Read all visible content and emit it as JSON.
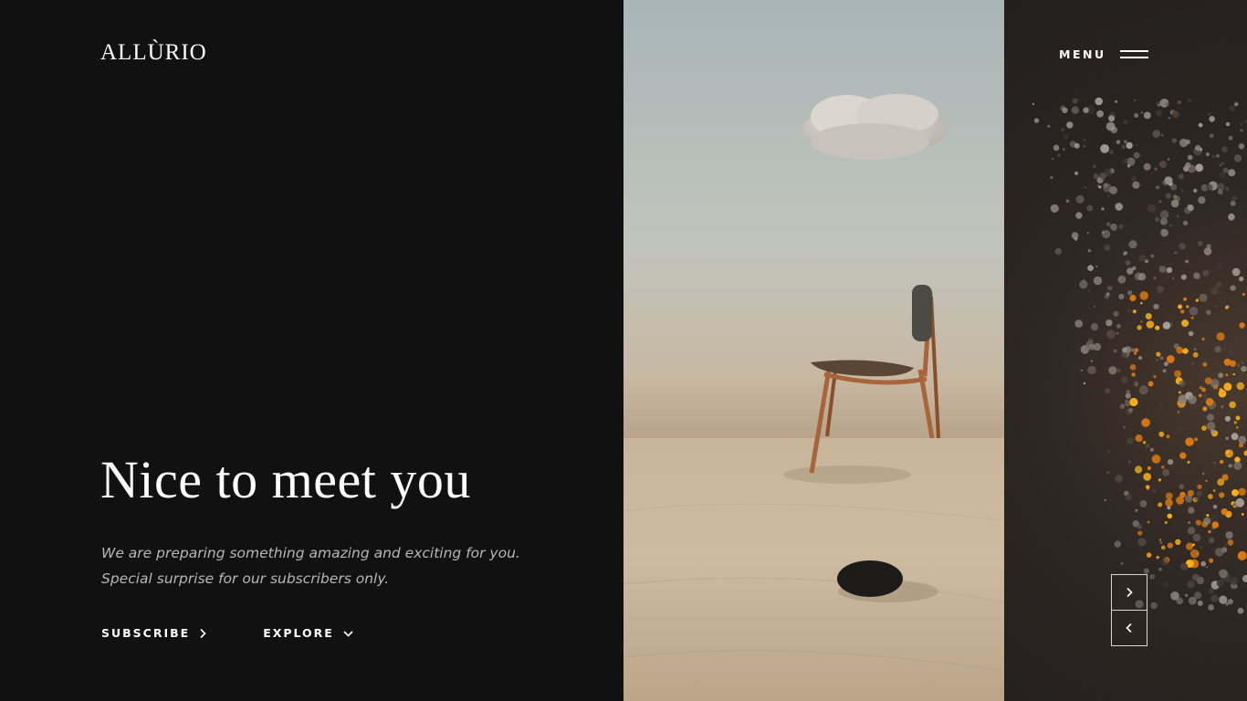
{
  "brand": {
    "logo": "ALLÙRIO"
  },
  "header": {
    "menu_label": "MENU",
    "menu_icon": "hamburger-icon"
  },
  "hero": {
    "title": "Nice to meet you",
    "description_lines": [
      "We are preparing something amazing and exciting for you.",
      "Special surprise for our subscribers only."
    ]
  },
  "actions": {
    "subscribe": {
      "label": "SUBSCRIBE",
      "icon": "chevron-right-icon"
    },
    "explore": {
      "label": "EXPLORE",
      "icon": "chevron-down-icon"
    }
  },
  "slider": {
    "next_icon": "chevron-right-icon",
    "prev_icon": "chevron-left-icon"
  },
  "colors": {
    "background": "#111111",
    "text": "#ffffff",
    "muted_text": "#b7b7b7",
    "glow": "#ffb21a"
  }
}
